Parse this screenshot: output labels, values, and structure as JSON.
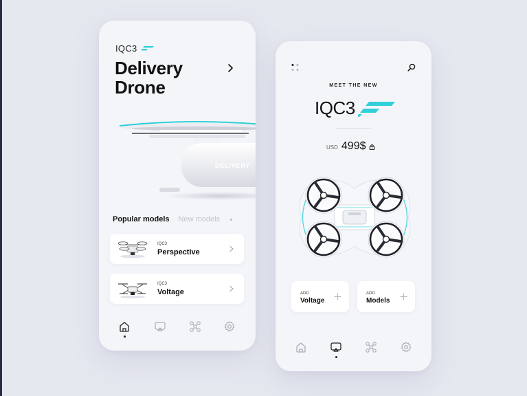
{
  "left_screen": {
    "brand": "IQC3",
    "title": "Delivery Drone",
    "drone_label": "DELIVERY",
    "tabs": [
      {
        "label": "Popular models",
        "active": true
      },
      {
        "label": "New models",
        "active": false
      }
    ],
    "models": [
      {
        "brand": "IQC3",
        "name": "Perspective"
      },
      {
        "brand": "IQC3",
        "name": "Voltage"
      }
    ],
    "nav": [
      {
        "icon": "home-icon",
        "active": true
      },
      {
        "icon": "cast-icon",
        "active": false
      },
      {
        "icon": "drone-icon",
        "active": false
      },
      {
        "icon": "gear-icon",
        "active": false
      }
    ]
  },
  "right_screen": {
    "eyebrow": "MEET THE NEW",
    "brand": "IQC3",
    "price": {
      "currency": "USD",
      "value": "499$"
    },
    "add_cards": [
      {
        "label": "ADD",
        "name": "Voltage"
      },
      {
        "label": "ADD",
        "name": "Models"
      }
    ],
    "nav": [
      {
        "icon": "home-icon",
        "active": false
      },
      {
        "icon": "cast-icon",
        "active": true
      },
      {
        "icon": "drone-icon",
        "active": false
      },
      {
        "icon": "gear-icon",
        "active": false
      }
    ]
  },
  "colors": {
    "accent": "#2fd0d8",
    "background": "#e6e8f0",
    "screen": "#f4f5f9",
    "text": "#111111",
    "muted": "#c0c3cc"
  }
}
